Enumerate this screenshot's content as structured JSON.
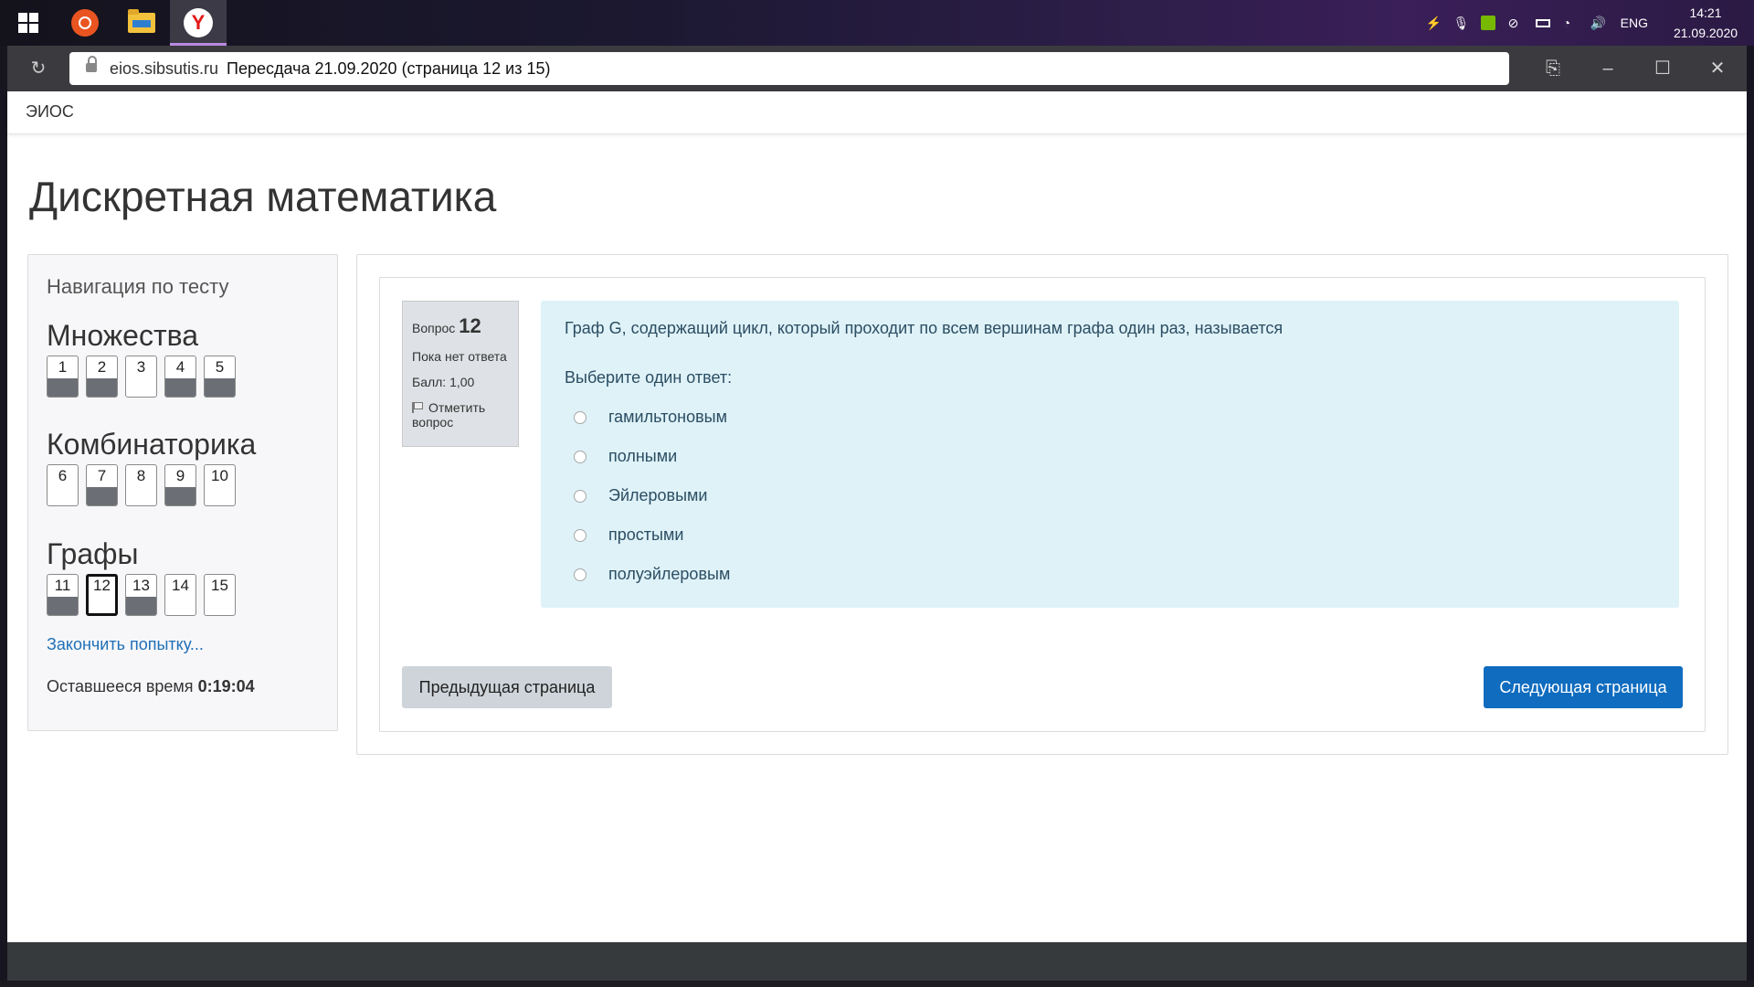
{
  "taskbar": {
    "apps": [
      "start",
      "ubuntu",
      "file-explorer",
      "yandex-browser"
    ],
    "language": "ENG",
    "time": "14:21",
    "date": "21.09.2020"
  },
  "browser": {
    "domain": "eios.sibsutis.ru",
    "page_title": "Пересдача 21.09.2020 (страница 12 из 15)"
  },
  "site": {
    "brand": "ЭИОС"
  },
  "course": {
    "title": "Дискретная математика"
  },
  "quiz_nav": {
    "heading": "Навигация по тесту",
    "sections": [
      {
        "title": "Множества",
        "questions": [
          {
            "num": "1",
            "state": "answered"
          },
          {
            "num": "2",
            "state": "answered"
          },
          {
            "num": "3",
            "state": "unanswered"
          },
          {
            "num": "4",
            "state": "answered"
          },
          {
            "num": "5",
            "state": "answered"
          }
        ]
      },
      {
        "title": "Комбинаторика",
        "questions": [
          {
            "num": "6",
            "state": "unanswered"
          },
          {
            "num": "7",
            "state": "answered"
          },
          {
            "num": "8",
            "state": "unanswered"
          },
          {
            "num": "9",
            "state": "answered"
          },
          {
            "num": "10",
            "state": "unanswered"
          }
        ]
      },
      {
        "title": "Графы",
        "questions": [
          {
            "num": "11",
            "state": "answered"
          },
          {
            "num": "12",
            "state": "current"
          },
          {
            "num": "13",
            "state": "answered"
          },
          {
            "num": "14",
            "state": "unanswered"
          },
          {
            "num": "15",
            "state": "unanswered"
          }
        ]
      }
    ],
    "finish_link": "Закончить попытку...",
    "time_label": "Оставшееся время",
    "time_value": "0:19:04"
  },
  "question": {
    "label": "Вопрос",
    "number": "12",
    "status": "Пока нет ответа",
    "grade": "Балл: 1,00",
    "flag_label_1": "Отметить",
    "flag_label_2": "вопрос",
    "text": "Граф G, содержащий цикл, который проходит по всем вершинам графа один раз, называется",
    "prompt": "Выберите один ответ:",
    "answers": [
      "гамильтоновым",
      "полными",
      "Эйлеровыми",
      "простыми",
      "полуэйлеровым"
    ]
  },
  "buttons": {
    "prev": "Предыдущая страница",
    "next": "Следующая страница"
  }
}
